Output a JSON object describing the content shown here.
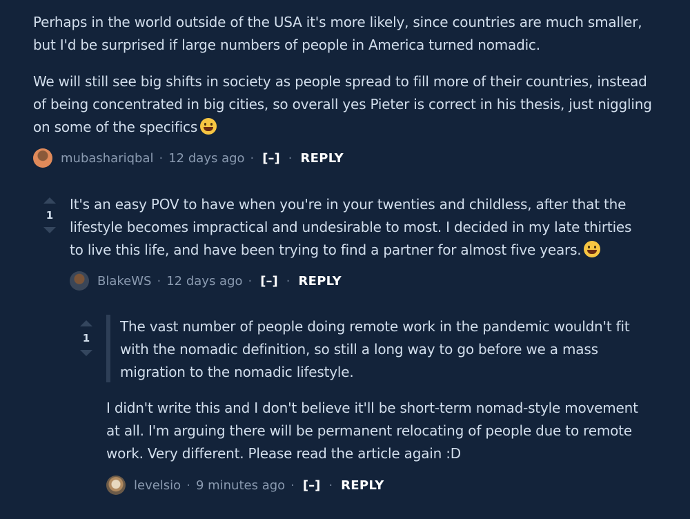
{
  "comments": [
    {
      "paragraphs": [
        "Perhaps in the world outside of the USA it's more likely, since countries are much smaller, but I'd be surprised if large numbers of people in America turned nomadic.",
        "We will still see big shifts in society as people spread to fill more of their countries, instead of being concentrated in big cities, so overall yes Pieter is correct in his thesis, just niggling on some of the specifics"
      ],
      "emoji": "grinning-face",
      "author": "mubashariqbal",
      "time": "12 days ago",
      "toggle": "[–]",
      "reply": "REPLY"
    },
    {
      "votes": "1",
      "text": "It's an easy POV to have when you're in your twenties and childless, after that the lifestyle becomes impractical and undesirable to most. I decided in my late thirties to live this life, and have been trying to find a partner for almost five years.",
      "emoji": "laughing-face",
      "author": "BlakeWS",
      "time": "12 days ago",
      "toggle": "[–]",
      "reply": "REPLY"
    },
    {
      "votes": "1",
      "quote": "The vast number of people doing remote work in the pandemic wouldn't fit with the nomadic definition, so still a long way to go before we a mass migration to the nomadic lifestyle.",
      "text": "I didn't write this and I don't believe it'll be short-term nomad-style movement at all. I'm arguing there will be permanent relocating of people due to remote work. Very different. Please read the article again :D",
      "author": "levelsio",
      "time": "9 minutes ago",
      "toggle": "[–]",
      "reply": "REPLY"
    }
  ],
  "separator": "·",
  "colors": {
    "background": "#13233a",
    "text": "#d2deec",
    "meta": "#8a9ab0",
    "vote_arrow": "#34465e",
    "quote_border": "#2e3f57"
  }
}
